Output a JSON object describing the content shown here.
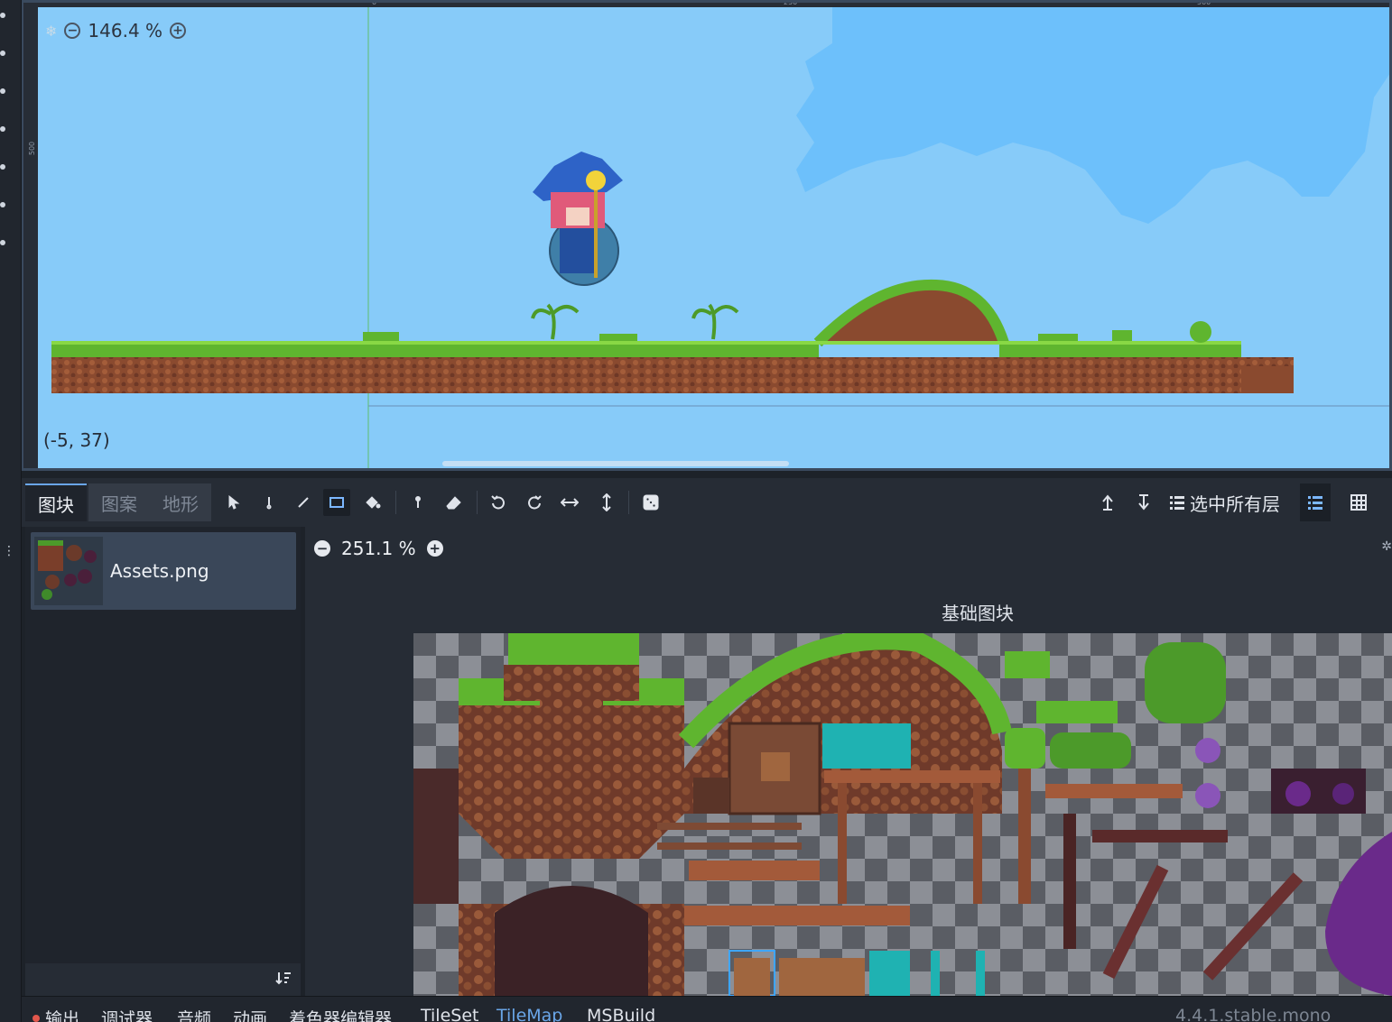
{
  "viewport": {
    "zoom_text": "146.4 %",
    "cursor_coords": "(-5, 37)",
    "ruler_top_ticks": [
      "0",
      "250",
      "500"
    ],
    "ruler_left_ticks": [
      "500"
    ],
    "sky_color": "#87cbf9",
    "cloud_color": "#6dc0fb"
  },
  "toolbar": {
    "tabs": [
      {
        "label": "图块",
        "active": true
      },
      {
        "label": "图案",
        "active": false
      },
      {
        "label": "地形",
        "active": false
      }
    ],
    "tools": [
      "select-icon",
      "paint-icon",
      "line-icon",
      "rect-icon",
      "bucket-icon",
      "picker-icon",
      "eraser-icon",
      "rotate-left-icon",
      "rotate-right-icon",
      "flip-h-icon",
      "flip-v-icon",
      "random-icon"
    ],
    "active_tool": "rect-icon",
    "layers_label": "选中所有层"
  },
  "tile_list": {
    "items": [
      {
        "name": "Assets.png"
      }
    ]
  },
  "atlas": {
    "zoom_text": "251.1 %",
    "title": "基础图块"
  },
  "bottom_tabs": [
    {
      "label": "输出",
      "active": false
    },
    {
      "label": "调试器",
      "active": false
    },
    {
      "label": "音频",
      "active": false
    },
    {
      "label": "动画",
      "active": false
    },
    {
      "label": "着色器编辑器",
      "active": false
    },
    {
      "label": "TileSet",
      "active": false
    },
    {
      "label": "TileMap",
      "active": true
    },
    {
      "label": "MSBuild",
      "active": false
    }
  ],
  "version": "4.4.1.stable.mono",
  "colors": {
    "accent": "#6aa6e8",
    "panel": "#262c35",
    "grass": "#5fb52f",
    "dirt": "#8a4a2f"
  }
}
